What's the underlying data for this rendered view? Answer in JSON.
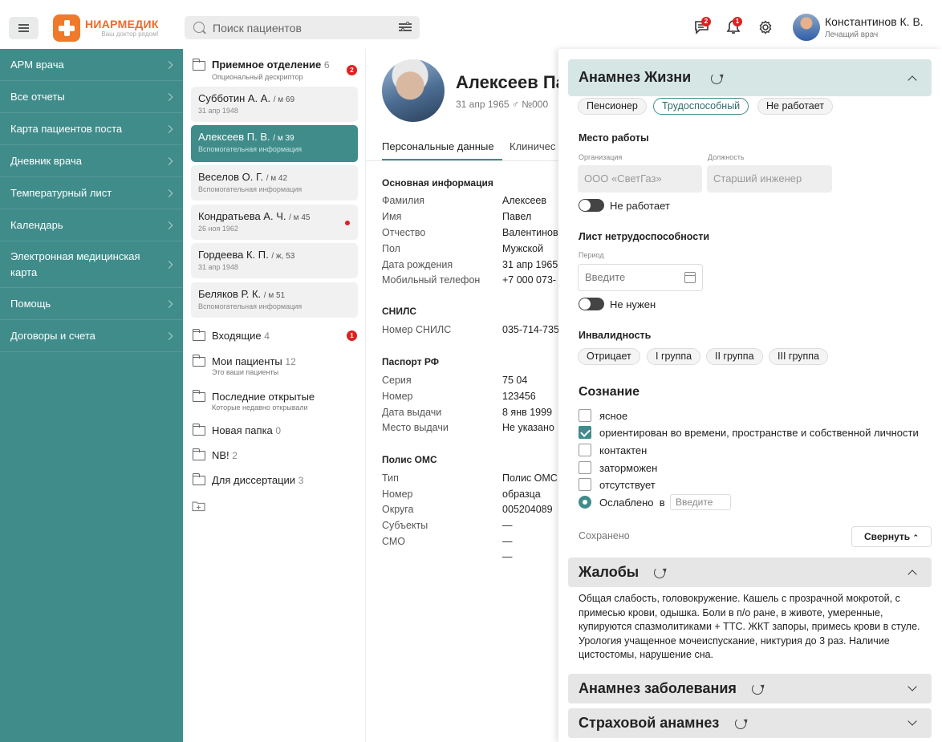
{
  "header": {
    "logo_name": "НИАРМЕДИК",
    "logo_sub": "Ваш доктор рядом!",
    "search_placeholder": "Поиск пациентов",
    "messages_badge": "2",
    "notifications_badge": "1",
    "user_name": "Константинов К. В.",
    "user_role": "Лечащий врач"
  },
  "sidebar": {
    "items": [
      {
        "label": "АРМ врача"
      },
      {
        "label": "Все отчеты"
      },
      {
        "label": "Карта пациентов поста"
      },
      {
        "label": "Дневник врача"
      },
      {
        "label": "Температурный лист"
      },
      {
        "label": "Календарь"
      },
      {
        "label": "Электронная медицинская карта"
      },
      {
        "label": "Помощь"
      },
      {
        "label": "Договоры и счета"
      }
    ]
  },
  "patients": {
    "reception": {
      "title": "Приемное отделение",
      "count": "6",
      "subtitle": "Опциональный дескриптор",
      "badge": "2"
    },
    "cards": [
      {
        "name": "Субботин А. А.",
        "meta": "/ м 69",
        "sub": "31 апр 1948"
      },
      {
        "name": "Алексеев П. В.",
        "meta": "/ м 39",
        "sub": "Вспомогательная информация"
      },
      {
        "name": "Веселов О. Г.",
        "meta": "/ м 42",
        "sub": "Вспомогательная информация"
      },
      {
        "name": "Кондратьева А. Ч.",
        "meta": "/ м 45",
        "sub": "26 ноя 1962"
      },
      {
        "name": "Гордеева К. П.",
        "meta": "/ ж, 53",
        "sub": "31 апр 1948"
      },
      {
        "name": "Беляков Р. К.",
        "meta": "/ м 51",
        "sub": "Вспомогательная информация"
      }
    ],
    "folders": [
      {
        "title": "Входящие",
        "count": "4",
        "sub": "",
        "badge": "1"
      },
      {
        "title": "Мои пациенты",
        "count": "12",
        "sub": "Это ваши пациенты"
      },
      {
        "title": "Последние открытые",
        "count": "",
        "sub": "Которые недавно открывали"
      },
      {
        "title": "Новая папка",
        "count": "0",
        "sub": ""
      },
      {
        "title": "NB!",
        "count": "2",
        "sub": ""
      },
      {
        "title": "Для диссертации",
        "count": "3",
        "sub": ""
      }
    ]
  },
  "patient": {
    "name": "Алексеев Па",
    "meta": "31 апр 1965 ♂ №000",
    "tabs": [
      "Персональные данные",
      "Клиничес"
    ],
    "main_info_title": "Основная информация",
    "main_info": [
      {
        "k": "Фамилия",
        "v": "Алексеев"
      },
      {
        "k": "Имя",
        "v": "Павел"
      },
      {
        "k": "Отчество",
        "v": "Валентинов"
      },
      {
        "k": "Пол",
        "v": "Мужской"
      },
      {
        "k": "Дата рождения",
        "v": "31 апр 1965"
      },
      {
        "k": "Мобильный телефон",
        "v": "+7 000 073-"
      }
    ],
    "snils_title": "СНИЛС",
    "snils": {
      "k": "Номер СНИЛС",
      "v": "035-714-735"
    },
    "passport_title": "Паспорт РФ",
    "passport": [
      {
        "k": "Серия",
        "v": "75 04"
      },
      {
        "k": "Номер",
        "v": "123456"
      },
      {
        "k": "Дата выдачи",
        "v": "8 янв 1999"
      },
      {
        "k": "Место выдачи",
        "v": "Не указано"
      }
    ],
    "oms_title": "Полис ОМС",
    "oms": [
      {
        "k": "Тип",
        "v": "Полис ОМС"
      },
      {
        "k": "Номер",
        "v": "образца"
      },
      {
        "k": "Округа",
        "v": "005204089"
      },
      {
        "k": "Субъекты",
        "v": "—"
      },
      {
        "k": "СМО",
        "v": "—"
      },
      {
        "k": "",
        "v": "—"
      }
    ]
  },
  "anamnesis": {
    "title": "Анамнез Жизни",
    "chips": [
      "Пенсионер",
      "Трудоспособный",
      "Не работает"
    ],
    "work_title": "Место работы",
    "org_label": "Организация",
    "org_value": "ООО «СветГаз»",
    "pos_label": "Должность",
    "pos_value": "Старший инженер",
    "not_working": "Не работает",
    "sick_title": "Лист нетрудоспособности",
    "period_label": "Период",
    "period_placeholder": "Введите",
    "not_needed": "Не нужен",
    "disability_title": "Инвалидность",
    "disability_chips": [
      "Отрицает",
      "I группа",
      "II группа",
      "III группа"
    ],
    "consciousness_title": "Сознание",
    "consciousness": [
      {
        "label": "ясное",
        "checked": false
      },
      {
        "label": "ориентирован во времени, пространстве и собственной личности",
        "checked": true
      },
      {
        "label": "контактен",
        "checked": false
      },
      {
        "label": "заторможен",
        "checked": false
      },
      {
        "label": "отсутствует",
        "checked": false
      }
    ],
    "weakened_label": "Ослаблено",
    "weakened_in": "в",
    "weakened_placeholder": "Введите",
    "saved": "Сохранено",
    "collapse": "Свернуть"
  },
  "complaints": {
    "title": "Жалобы",
    "text": "Общая слабость, головокружение. Кашель с прозрачной мокротой, с примесью крови, одышка. Боли в п/о ране, в животе, умеренные, купируются спазмолитиками + ТТС. ЖКТ запоры, примесь крови в стуле. Урология учащенное мочеиспускание, никтурия до 3 раз. Наличие цистостомы, нарушение сна."
  },
  "disease_anamnesis": {
    "title": "Анамнез заболевания"
  },
  "insurance_anamnesis": {
    "title": "Страховой анамнез"
  }
}
